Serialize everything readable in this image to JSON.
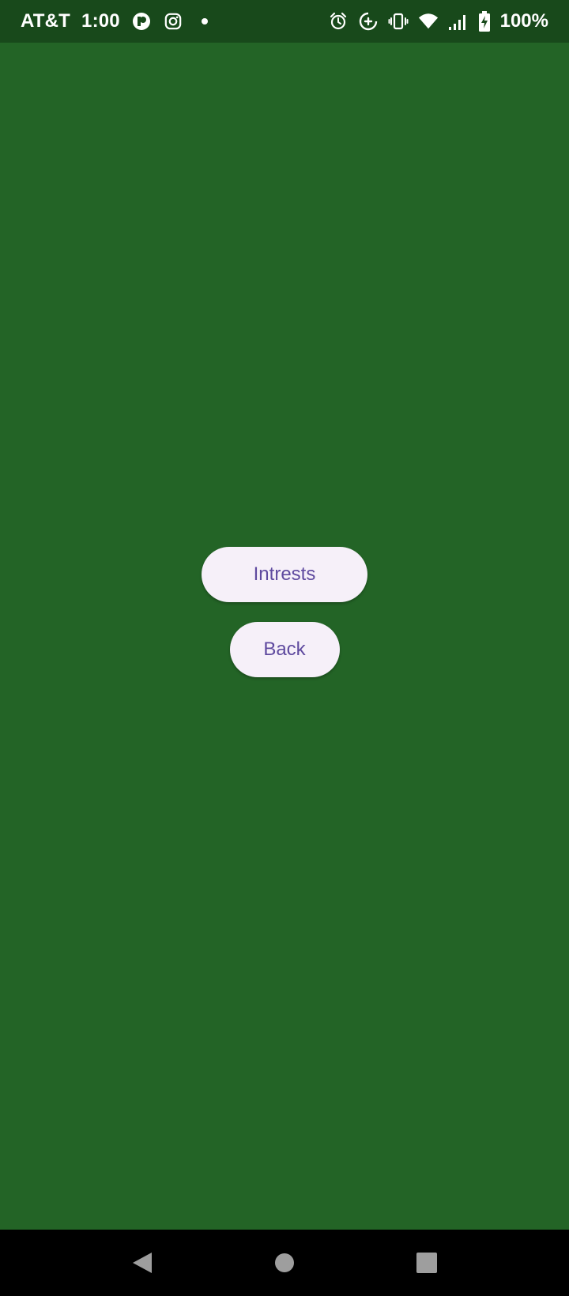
{
  "status_bar": {
    "carrier": "AT&T",
    "time": "1:00",
    "battery_percent": "100%",
    "left_icons": [
      "app-notification-icon",
      "instagram-icon",
      "dot-icon"
    ],
    "right_icons": [
      "alarm-icon",
      "data-saver-icon",
      "vibrate-icon",
      "wifi-icon",
      "signal-icon",
      "battery-charging-icon"
    ]
  },
  "main": {
    "interests_button_label": "Intrests",
    "back_button_label": "Back"
  },
  "nav_bar": {
    "icons": [
      "back-triangle-icon",
      "home-circle-icon",
      "recents-square-icon"
    ]
  },
  "colors": {
    "background": "#236426",
    "status_bar": "#18491b",
    "button_bg": "#f6f0f9",
    "button_text": "#5f4a9f",
    "nav_bar": "#000000"
  }
}
